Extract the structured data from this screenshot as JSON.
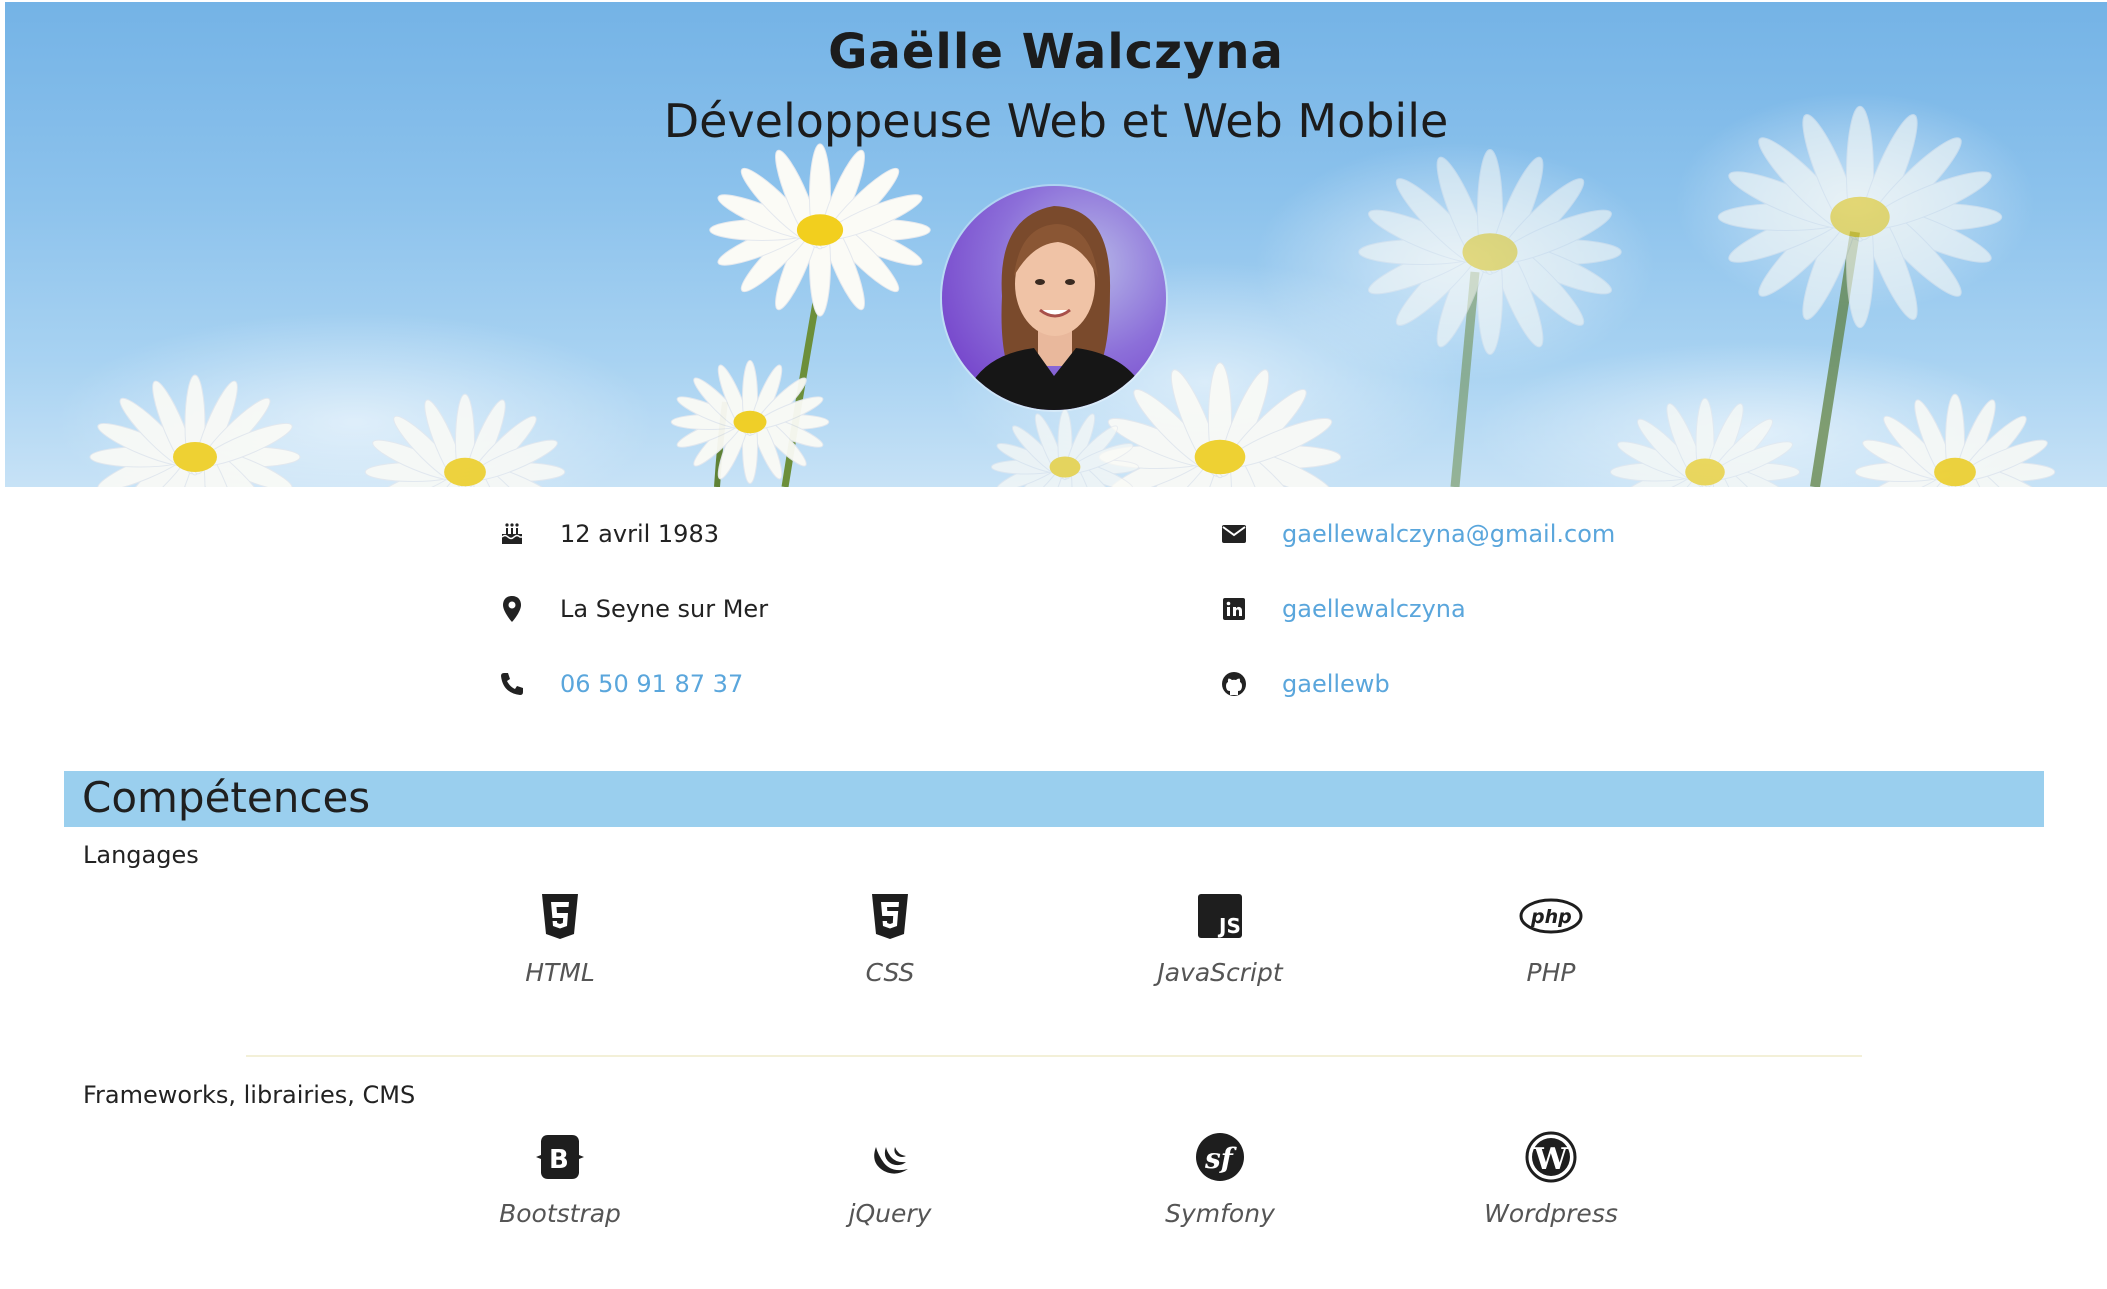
{
  "header": {
    "name": "Gaëlle Walczyna",
    "job_title": "Développeuse Web et Web Mobile"
  },
  "contact": {
    "left": [
      {
        "icon": "birthday-cake-icon",
        "text": "12 avril 1983",
        "link": false
      },
      {
        "icon": "map-marker-icon",
        "text": "La Seyne sur Mer",
        "link": false
      },
      {
        "icon": "phone-icon",
        "text": "06 50 91 87 37",
        "link": true
      }
    ],
    "right": [
      {
        "icon": "envelope-icon",
        "text": "gaellewalczyna@gmail.com",
        "link": true
      },
      {
        "icon": "linkedin-icon",
        "text": "gaellewalczyna",
        "link": true
      },
      {
        "icon": "github-icon",
        "text": "gaellewb",
        "link": true
      }
    ],
    "link_color": "#5aa6dc"
  },
  "skills": {
    "title": "Compétences",
    "bar_color": "#9acfee",
    "languages": {
      "heading": "Langages",
      "items": [
        {
          "icon": "html5-icon",
          "label": "HTML"
        },
        {
          "icon": "css3-icon",
          "label": "CSS"
        },
        {
          "icon": "javascript-icon",
          "label": "JavaScript"
        },
        {
          "icon": "php-icon",
          "label": "PHP"
        }
      ]
    },
    "frameworks": {
      "heading": "Frameworks, librairies, CMS",
      "items": [
        {
          "icon": "bootstrap-icon",
          "label": "Bootstrap"
        },
        {
          "icon": "jquery-icon",
          "label": "jQuery"
        },
        {
          "icon": "symfony-icon",
          "label": "Symfony"
        },
        {
          "icon": "wordpress-icon",
          "label": "Wordpress"
        }
      ]
    }
  }
}
